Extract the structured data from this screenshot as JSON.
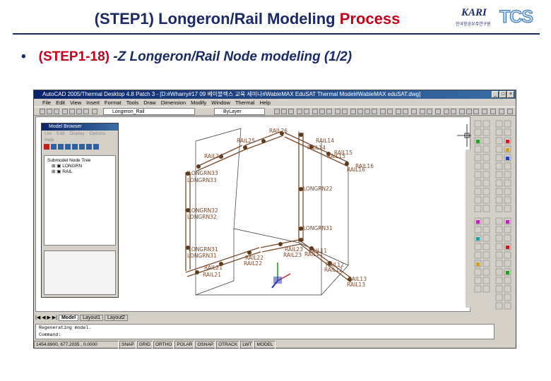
{
  "slide": {
    "title_prefix": "(STEP1) Longeron/Rail Modeling ",
    "title_highlight": "Process",
    "bullet": "•",
    "step_label": "(STEP1-18)",
    "step_desc": "-Z Longeron/Rail Node modeling (1/2)",
    "logo_kari": "KARI",
    "logo_kari_sub": "한국항공우주연구원",
    "logo_tcs": "TCS"
  },
  "window": {
    "title": "AutoCAD 2005/Thermal Desktop 4.8 Patch 3 - [D:#Wharry#17 09 베이블렉스 교육 세미나#WableMAX EduSAT Thermal Model#WableMAX eduSAT.dwg]",
    "menu": [
      "File",
      "Edit",
      "View",
      "Insert",
      "Format",
      "Tools",
      "Draw",
      "Dimension",
      "Modify",
      "Window",
      "Thermal",
      "Help"
    ],
    "layer_combo": "Longeron_Rail",
    "linetype_combo": "ByLayer",
    "colors": {
      "title_start": "#0a246a",
      "title_end": "#3a6ea5",
      "model": "#7a4a2a",
      "node": "#5a3a18"
    }
  },
  "model_browser": {
    "title": "Model Browser",
    "menu": [
      "List",
      "Edit",
      "Display",
      "Options",
      "Help"
    ],
    "tree_root": "Submodel Node Tree",
    "tree_items": [
      "LONGRN",
      "RAIL"
    ]
  },
  "drawing": {
    "labels": [
      "RAIL14",
      "RAIL15",
      "RAIL16",
      "RAIL26",
      "RAIL25",
      "RAIL24",
      "RAIL14",
      "RAIL15",
      "RAIL16",
      "LONGRN33",
      "LONGRN33",
      "LONGRN22",
      "LONGRN32",
      "LONGRN32",
      "LONGRN31",
      "LONGRN31",
      "LONGRN31",
      "RAIL11",
      "RAIL12",
      "RAIL13",
      "RAIL21",
      "RAIL22",
      "RAIL23",
      "RAIL21",
      "RAIL22",
      "RAIL23",
      "RAIL11",
      "RAIL12",
      "RAIL13"
    ]
  },
  "tabs": [
    "Model",
    "Layout1",
    "Layout2"
  ],
  "command": {
    "line1": "Regenerating model.",
    "line2": "Command:"
  },
  "statusbar": {
    "coords": "1454.6900, 677.2035 , 0.0000",
    "buttons": [
      "SNAP",
      "GRID",
      "ORTHO",
      "POLAR",
      "OSNAP",
      "OTRACK",
      "LWT",
      "MODEL"
    ]
  }
}
